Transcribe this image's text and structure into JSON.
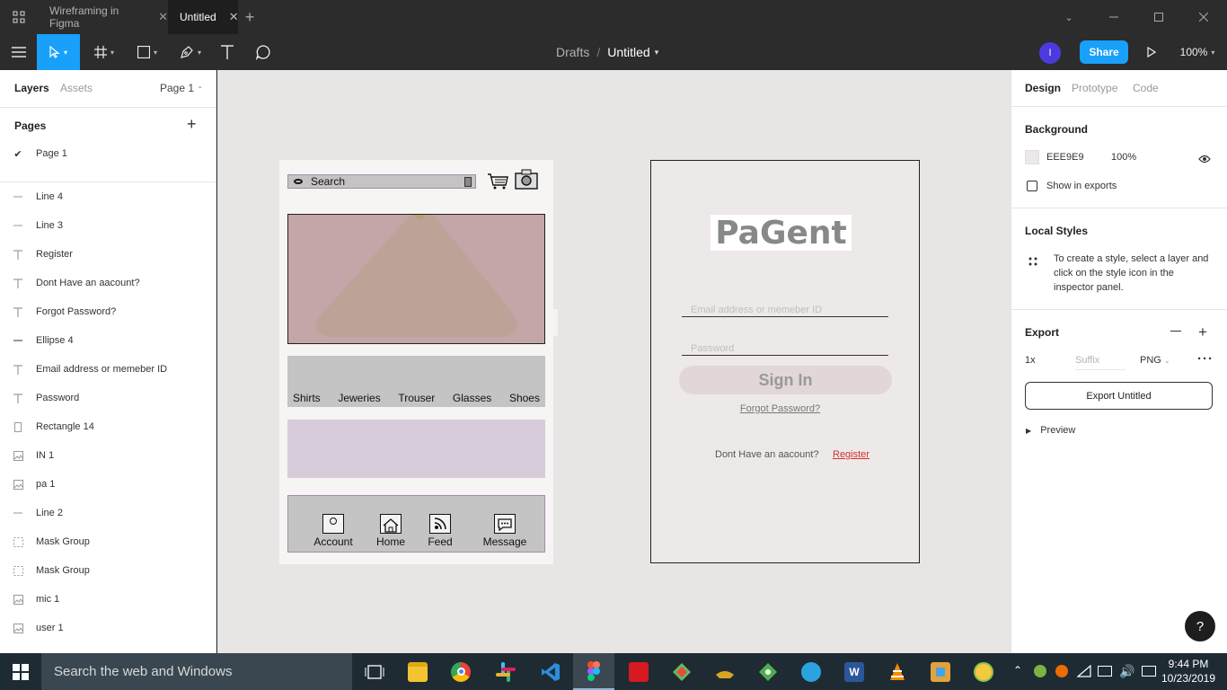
{
  "titlebar": {
    "tabs": [
      {
        "label": "Wireframing in Figma"
      },
      {
        "label": "Untitled"
      }
    ],
    "new_tab": "+"
  },
  "toolbar": {
    "breadcrumb_parent": "Drafts",
    "breadcrumb_sep": "/",
    "file_name": "Untitled",
    "avatar_initial": "I",
    "share_label": "Share",
    "zoom": "100%"
  },
  "left_panel": {
    "tabs": {
      "layers": "Layers",
      "assets": "Assets",
      "page_select": "Page 1"
    },
    "pages_title": "Pages",
    "add_page": "+",
    "current_page": "Page 1",
    "layers": [
      {
        "name": "Line 4",
        "icon": "line-icon"
      },
      {
        "name": "Line 3",
        "icon": "line-icon"
      },
      {
        "name": "Register",
        "icon": "text-icon"
      },
      {
        "name": "Dont Have an aacount?",
        "icon": "text-icon"
      },
      {
        "name": "Forgot Password?",
        "icon": "text-icon"
      },
      {
        "name": "Ellipse 4",
        "icon": "ellipse-icon"
      },
      {
        "name": "Email address or memeber ID",
        "icon": "text-icon"
      },
      {
        "name": "Password",
        "icon": "text-icon"
      },
      {
        "name": "Rectangle 14",
        "icon": "rectangle-icon"
      },
      {
        "name": "IN 1",
        "icon": "image-icon"
      },
      {
        "name": "pa 1",
        "icon": "image-icon"
      },
      {
        "name": "Line 2",
        "icon": "line-icon"
      },
      {
        "name": "Mask Group",
        "icon": "mask-icon"
      },
      {
        "name": "Mask Group",
        "icon": "mask-icon"
      },
      {
        "name": "mic 1",
        "icon": "image-icon"
      },
      {
        "name": "user 1",
        "icon": "image-icon"
      }
    ]
  },
  "canvas": {
    "shop_frame": {
      "search_label": "Search",
      "categories": [
        "Shirts",
        "Jeweries",
        "Trouser",
        "Glasses",
        "Shoes"
      ],
      "nav": [
        "Account",
        "Home",
        "Feed",
        "Message"
      ]
    },
    "login_frame": {
      "logo": "PaGent",
      "email_placeholder": "Email address or memeber ID",
      "password_placeholder": "Password",
      "sign_in": "Sign In",
      "forgot": "Forgot Password?",
      "no_account": "Dont Have an aacount?",
      "register": "Register"
    }
  },
  "right_panel": {
    "tabs": {
      "design": "Design",
      "prototype": "Prototype",
      "code": "Code"
    },
    "background": {
      "title": "Background",
      "hex": "EEE9E9",
      "opacity": "100%",
      "show_in_exports": "Show in exports"
    },
    "local_styles": {
      "title": "Local Styles",
      "hint": "To create a style, select a layer and click on the style icon in the inspector panel."
    },
    "export": {
      "title": "Export",
      "scale": "1x",
      "suffix_placeholder": "Suffix",
      "format": "PNG",
      "button": "Export Untitled",
      "preview": "Preview"
    }
  },
  "help": "?",
  "taskbar": {
    "search_placeholder": "Search the web and Windows",
    "time": "9:44 PM",
    "date": "10/23/2019"
  },
  "colors": {
    "accent": "#18a0fb",
    "toolbar": "#2c2c2c",
    "canvas": "#e8e6e5",
    "frame_bg": "#eee9e9",
    "taskbar": "#1f2b33"
  }
}
